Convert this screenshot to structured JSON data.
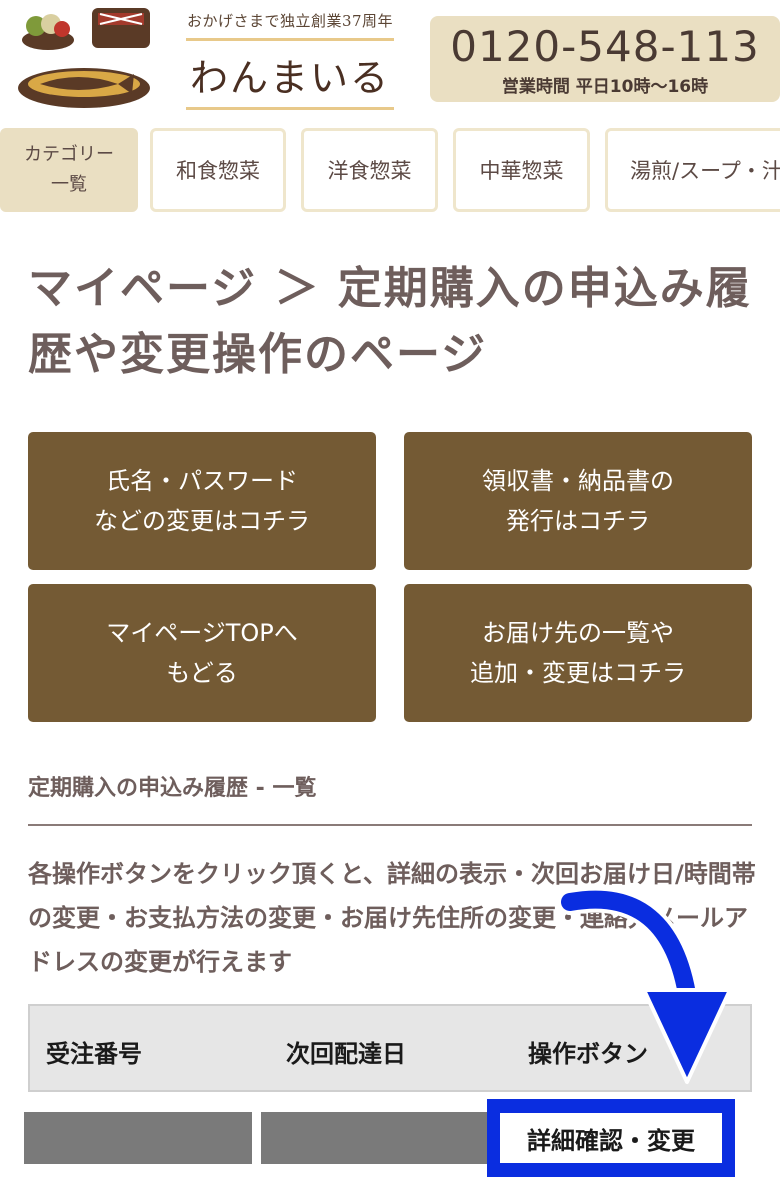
{
  "header": {
    "tagline": "おかげさまで独立創業37周年",
    "logo_text": "わんまいる",
    "phone_number": "0120-548-113",
    "business_hours": "営業時間 平日10時〜16時"
  },
  "category_nav": {
    "items": [
      {
        "label": "カテゴリー\n一覧"
      },
      {
        "label": "和食惣菜"
      },
      {
        "label": "洋食惣菜"
      },
      {
        "label": "中華惣菜"
      },
      {
        "label": "湯煎/スープ・汁"
      }
    ]
  },
  "page": {
    "title": "マイページ ＞ 定期購入の申込み履歴や変更操作のページ"
  },
  "actions": [
    {
      "label": "氏名・パスワード\nなどの変更はコチラ"
    },
    {
      "label": "領収書・納品書の\n発行はコチラ"
    },
    {
      "label": "マイページTOPへ\nもどる"
    },
    {
      "label": "お届け先の一覧や\n追加・変更はコチラ"
    }
  ],
  "section": {
    "heading": "定期購入の申込み履歴 - 一覧",
    "description": "各操作ボタンをクリック頂くと、詳細の表示・次回お届け日/時間帯の変更・お支払方法の変更・お届け先住所の変更・連絡先メールアドレスの変更が行えます"
  },
  "table": {
    "headers": [
      "受注番号",
      "次回配達日",
      "操作ボタン"
    ],
    "row_action_label": "詳細確認・変更"
  },
  "colors": {
    "action_button": "#745a34",
    "nav_active": "#eadfc2",
    "highlight": "#0a2de0"
  }
}
